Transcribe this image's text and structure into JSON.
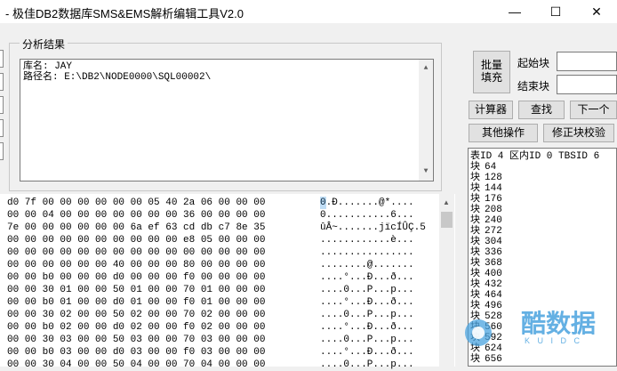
{
  "window": {
    "title": "- 极佳DB2数据库SMS&EMS解析编辑工具V2.0",
    "controls": [
      "—",
      "☐",
      "✕"
    ]
  },
  "analysis": {
    "legend": "分析结果",
    "lines": [
      "库名: JAY",
      "路径名: E:\\DB2\\NODE0000\\SQL00002\\"
    ]
  },
  "controls": {
    "batch_fill": [
      "批量",
      "填充"
    ],
    "start_block_label": "起始块",
    "start_block_value": "",
    "end_block_label": "结束块",
    "end_block_value": "",
    "calculator": "计算器",
    "find": "查找",
    "next": "下一个",
    "other_ops": "其他操作",
    "fix_checksum": "修正块校验"
  },
  "hex": {
    "rows": [
      {
        "hex": "d0 7f 00 00 00 00 00 00 05 40 2a 06 00 00 00",
        "ascii": "0.Ð.......@*...."
      },
      {
        "hex": "00 00 04 00 00 00 00 00 00 00 36 00 00 00 00",
        "ascii": "0...........6..."
      },
      {
        "hex": "7e 00 00 00 00 00 00 6a ef 63 cd db c7 8e 35",
        "ascii": "ûÂ~.......jïcÍÛÇ.5"
      },
      {
        "hex": "00 00 00 00 00 00 00 00 00 00 e8 05 00 00 00",
        "ascii": "............è..."
      },
      {
        "hex": "00 00 00 00 00 00 00 00 00 00 00 00 00 00 00",
        "ascii": "................"
      },
      {
        "hex": "00 00 00 00 00 00 40 00 00 00 80 00 00 00 00",
        "ascii": "........@......."
      },
      {
        "hex": "00 00 b0 00 00 00 d0 00 00 00 f0 00 00 00 00",
        "ascii": "....°...Ð...ð..."
      },
      {
        "hex": "00 00 30 01 00 00 50 01 00 00 70 01 00 00 00",
        "ascii": "....0...P...p..."
      },
      {
        "hex": "00 00 b0 01 00 00 d0 01 00 00 f0 01 00 00 00",
        "ascii": "....°...Ð...ð..."
      },
      {
        "hex": "00 00 30 02 00 00 50 02 00 00 70 02 00 00 00",
        "ascii": "....0...P...p..."
      },
      {
        "hex": "00 00 b0 02 00 00 d0 02 00 00 f0 02 00 00 00",
        "ascii": "....°...Ð...ð..."
      },
      {
        "hex": "00 00 30 03 00 00 50 03 00 00 70 03 00 00 00",
        "ascii": "....0...P...p..."
      },
      {
        "hex": "00 00 b0 03 00 00 d0 03 00 00 f0 03 00 00 00",
        "ascii": "....°...Ð...ð..."
      },
      {
        "hex": "00 00 30 04 00 00 50 04 00 00 70 04 00 00 00",
        "ascii": "....0...P...p..."
      }
    ]
  },
  "blocks": {
    "header": "表ID 4 区内ID 0 TBSID 6",
    "prefix": "块",
    "values": [
      "64",
      "128",
      "144",
      "176",
      "208",
      "240",
      "272",
      "304",
      "336",
      "368",
      "400",
      "432",
      "464",
      "496",
      "528",
      "560",
      "592",
      "624",
      "656"
    ]
  },
  "watermark": {
    "text": "酷数据",
    "sub": "K U I D C"
  },
  "colors": {
    "accent": "#0078d7",
    "watermark": "#4aa3df"
  }
}
